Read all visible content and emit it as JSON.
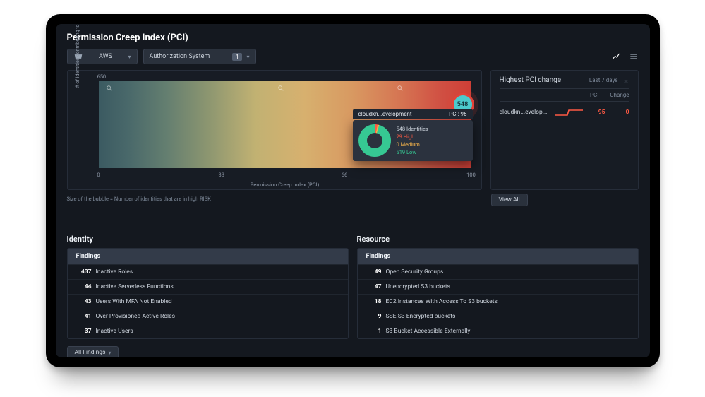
{
  "page_title": "Permission Creep Index (PCI)",
  "toolbar": {
    "provider_label": "AWS",
    "auth_label": "Authorization System",
    "auth_count": "1"
  },
  "chart": {
    "y_label": "# of Identities contributing to PCI",
    "y_top": "650",
    "x_label": "Permission Creep Index (PCI)",
    "x0": "0",
    "x33": "33",
    "x66": "66",
    "x100": "100",
    "bubble": "548",
    "caption": "Size of the bubble = Number of identities that are in high RISK"
  },
  "tooltip": {
    "name": "cloudkn...evelopment",
    "pci_label": "PCI: 96",
    "total": "548 Identities",
    "high": "29 High",
    "medium": "0 Medium",
    "low": "519 Low"
  },
  "change_panel": {
    "title": "Highest PCI change",
    "range": "Last 7 days",
    "th_pci": "PCI",
    "th_change": "Change",
    "entry_name": "cloudkn...evelop...",
    "entry_pci": "95",
    "entry_change": "0",
    "view_all": "View All"
  },
  "identity": {
    "title": "Identity",
    "subheader": "Findings",
    "items": [
      {
        "count": "437",
        "label": "Inactive Roles"
      },
      {
        "count": "44",
        "label": "Inactive Serverless Functions"
      },
      {
        "count": "43",
        "label": "Users With MFA Not Enabled"
      },
      {
        "count": "41",
        "label": "Over Provisioned Active Roles"
      },
      {
        "count": "37",
        "label": "Inactive Users"
      }
    ]
  },
  "resource": {
    "title": "Resource",
    "subheader": "Findings",
    "items": [
      {
        "count": "49",
        "label": "Open Security Groups"
      },
      {
        "count": "47",
        "label": "Unencrypted S3 buckets"
      },
      {
        "count": "18",
        "label": "EC2 Instances With Access To S3 buckets"
      },
      {
        "count": "9",
        "label": "SSE-S3 Encrypted buckets"
      },
      {
        "count": "1",
        "label": "S3 Bucket Accessible Externally"
      }
    ]
  },
  "all_findings": "All Findings",
  "chart_data": {
    "type": "scatter",
    "xlabel": "Permission Creep Index (PCI)",
    "ylabel": "# of Identities contributing to PCI",
    "xlim": [
      0,
      100
    ],
    "ylim": [
      0,
      650
    ],
    "series": [
      {
        "name": "cloudkn...evelopment",
        "x": 96,
        "y": 548,
        "high": 29,
        "medium": 0,
        "low": 519
      }
    ],
    "annotations": [
      "bubble size = identities in high risk"
    ]
  }
}
